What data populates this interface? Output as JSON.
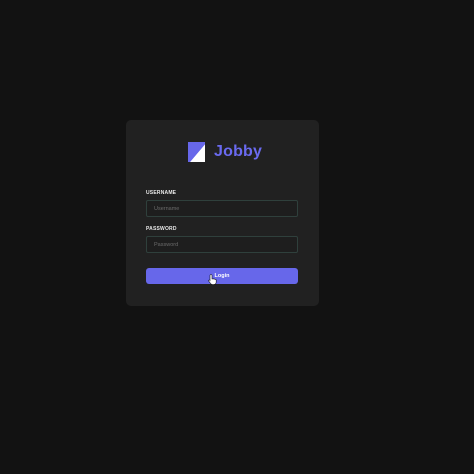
{
  "brand": {
    "name": "Jobby",
    "icon": "jobby-logo-icon",
    "color": "#6a6af0"
  },
  "form": {
    "username_label": "USERNAME",
    "username_placeholder": "Username",
    "username_value": "",
    "password_label": "PASSWORD",
    "password_placeholder": "Password",
    "password_value": "",
    "login_label": "Login"
  },
  "colors": {
    "background": "#121212",
    "card": "#212121",
    "accent": "#6767ea",
    "field_border": "#2f403c"
  },
  "cursor": {
    "icon": "hand-pointer-cursor-icon"
  }
}
